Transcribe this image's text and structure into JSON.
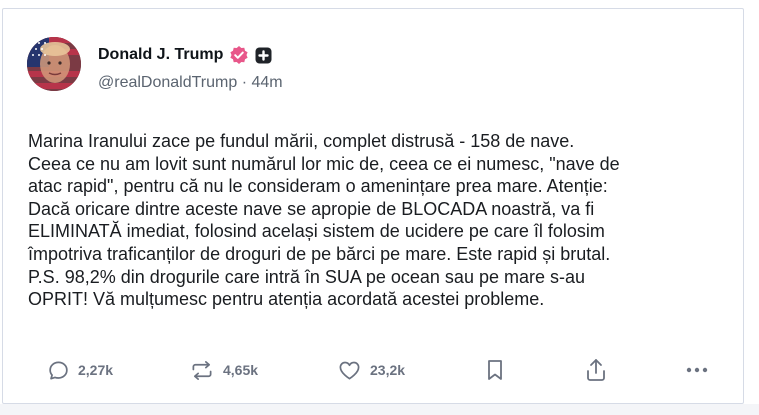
{
  "post": {
    "author": {
      "display_name": "Donald J. Trump",
      "handle": "@realDonaldTrump",
      "separator": "·",
      "time_ago": "44m",
      "verified_icon": "verified-badge-icon",
      "verified_color": "#e8578a",
      "extra_icon": "plus-square-icon"
    },
    "text": "Marina Iranului zace pe fundul mării, complet distrusă - 158 de nave.\nCeea ce nu am lovit sunt numărul lor mic de, ceea ce ei numesc, \"nave de\natac rapid\", pentru că nu le consideram o amenințare prea mare. Atenție:\nDacă oricare dintre aceste nave se apropie de BLOCADA noastră, va fi\nELIMINATĂ imediat, folosind același sistem de ucidere pe care îl folosim\nîmpotriva traficanților de droguri de pe bărci pe mare. Este rapid și brutal.\nP.S. 98,2% din drogurile care intră în SUA pe ocean sau pe mare s-au\nOPRIT! Vă mulțumesc pentru atenția acordată acestei probleme.",
    "actions": {
      "replies": {
        "icon": "comment-icon",
        "count": "2,27k"
      },
      "reposts": {
        "icon": "repost-icon",
        "count": "4,65k"
      },
      "likes": {
        "icon": "heart-icon",
        "count": "23,2k"
      },
      "bookmark": {
        "icon": "bookmark-icon"
      },
      "share": {
        "icon": "share-icon"
      },
      "more": {
        "icon": "more-icon"
      }
    }
  },
  "colors": {
    "text": "#1a1d21",
    "muted": "#5b6470",
    "icon": "#6b7280",
    "card_border": "#d6dbe6"
  }
}
